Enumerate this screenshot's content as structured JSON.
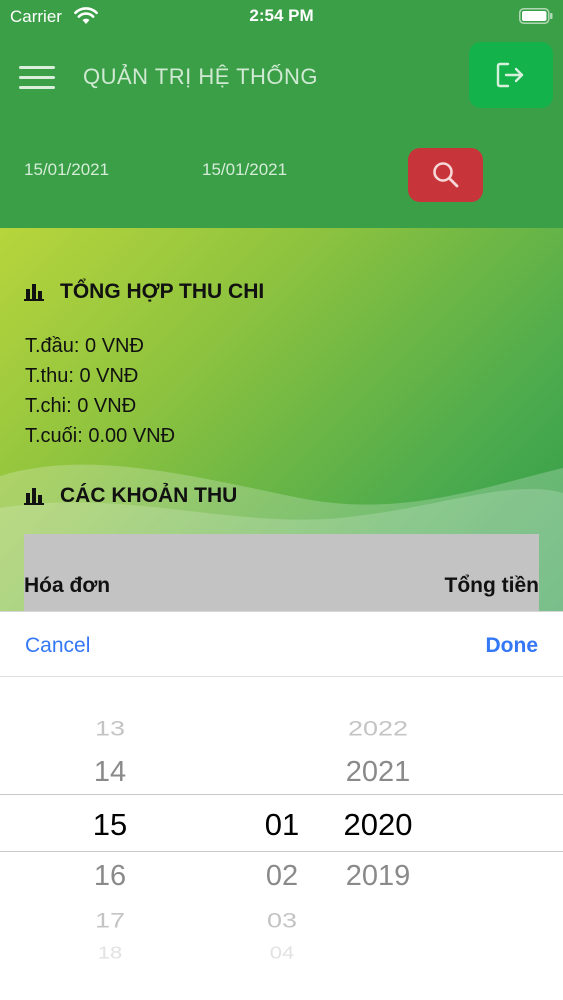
{
  "status_bar": {
    "carrier": "Carrier",
    "time": "2:54 PM"
  },
  "header": {
    "title": "QUẢN TRỊ HỆ THỐNG"
  },
  "filters": {
    "date_from": "15/01/2021",
    "date_to": "15/01/2021"
  },
  "summary": {
    "title": "TỔNG HỢP THU CHI",
    "lines": [
      "T.đầu: 0 VNĐ",
      "T.thu: 0 VNĐ",
      "T.chi: 0 VNĐ",
      "T.cuối: 0.00 VNĐ"
    ]
  },
  "income": {
    "title": "CÁC KHOẢN THU",
    "table": {
      "columns": [
        "Hóa đơn",
        "Tổng tiền"
      ]
    }
  },
  "picker": {
    "cancel_label": "Cancel",
    "done_label": "Done",
    "day": {
      "items": [
        "13",
        "14",
        "15",
        "16",
        "17",
        "18"
      ],
      "selected": "15"
    },
    "month": {
      "items": [
        "01",
        "02",
        "03",
        "04"
      ],
      "selected": "01"
    },
    "year": {
      "items": [
        "2022",
        "2021",
        "2020",
        "2019"
      ],
      "selected": "2020"
    }
  }
}
